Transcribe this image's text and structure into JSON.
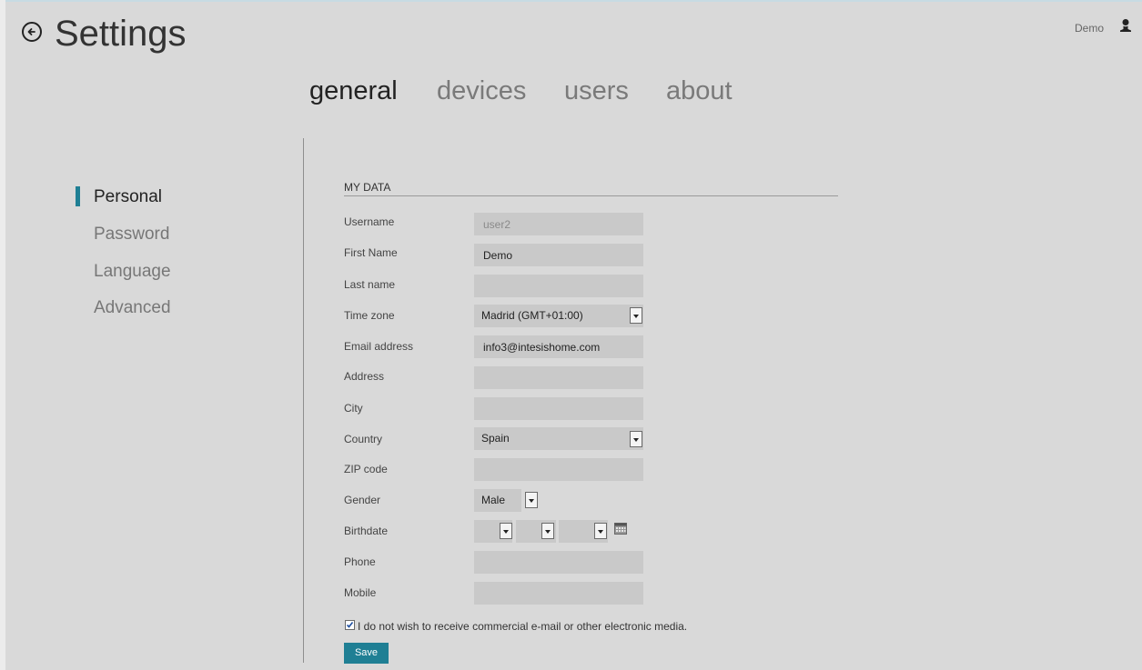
{
  "header": {
    "title": "Settings",
    "back_icon": "back-arrow-circle-icon",
    "user_name": "Demo",
    "user_icon": "user-icon"
  },
  "tabs": [
    {
      "label": "general",
      "active": true
    },
    {
      "label": "devices",
      "active": false
    },
    {
      "label": "users",
      "active": false
    },
    {
      "label": "about",
      "active": false
    }
  ],
  "sidebar": {
    "items": [
      {
        "label": "Personal",
        "active": true
      },
      {
        "label": "Password",
        "active": false
      },
      {
        "label": "Language",
        "active": false
      },
      {
        "label": "Advanced",
        "active": false
      }
    ]
  },
  "form": {
    "section_title": "MY DATA",
    "fields": {
      "username": {
        "label": "Username",
        "value": "user2"
      },
      "first_name": {
        "label": "First Name",
        "value": "Demo"
      },
      "last_name": {
        "label": "Last name",
        "value": ""
      },
      "time_zone": {
        "label": "Time zone",
        "value": "Madrid (GMT+01:00)"
      },
      "email": {
        "label": "Email address",
        "value": "info3@intesishome.com"
      },
      "address": {
        "label": "Address",
        "value": ""
      },
      "city": {
        "label": "City",
        "value": ""
      },
      "country": {
        "label": "Country",
        "value": "Spain"
      },
      "zip": {
        "label": "ZIP code",
        "value": ""
      },
      "gender": {
        "label": "Gender",
        "value": "Male"
      },
      "birthdate": {
        "label": "Birthdate",
        "day": "",
        "month": "",
        "year": ""
      },
      "phone": {
        "label": "Phone",
        "value": ""
      },
      "mobile": {
        "label": "Mobile",
        "value": ""
      }
    },
    "opt_out": {
      "checked": true,
      "label": "I do not wish to receive commercial e-mail or other electronic media."
    },
    "save_label": "Save"
  },
  "colors": {
    "accent": "#1f7f94",
    "background": "#d9d9d9",
    "field_background": "#c9c9c9"
  }
}
